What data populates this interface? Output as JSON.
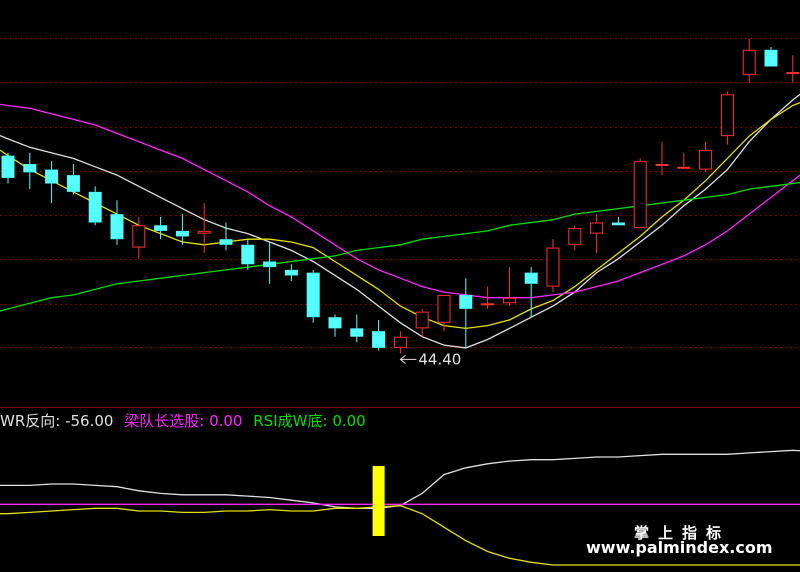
{
  "colors": {
    "background": "#000000",
    "grid": "#7a0000",
    "up": "#ff3232",
    "down": "#54ffff",
    "ma5": "#e0e0e0",
    "ma10": "#e6e000",
    "ma20": "#ff28ff",
    "ma60": "#00dd00",
    "white_line": "#e0e0e0",
    "yellow_line": "#e6e000",
    "magenta_line": "#ff28ff",
    "signal_bar": "#ffff00"
  },
  "legend": {
    "wr_label": "WR反向:",
    "wr_value": "-56.00",
    "lk_label": "梁队长选股:",
    "lk_value": "0.00",
    "rsi_label": "RSI成W底:",
    "rsi_value": "0.00"
  },
  "low_marker": "44.40",
  "watermark": {
    "line1": "掌上指标",
    "line2": "www.palmindex.com"
  },
  "chart_data": [
    {
      "type": "candlestick",
      "title": "",
      "ylim": [
        42.4,
        56.4
      ],
      "low_annotation": 44.4,
      "candles": [
        {
          "o": 51.1,
          "h": 51.2,
          "l": 50.1,
          "c": 50.3
        },
        {
          "o": 50.8,
          "h": 51.2,
          "l": 49.9,
          "c": 50.5
        },
        {
          "o": 50.6,
          "h": 50.9,
          "l": 49.4,
          "c": 50.1
        },
        {
          "o": 50.4,
          "h": 50.8,
          "l": 49.7,
          "c": 49.8
        },
        {
          "o": 49.8,
          "h": 50.0,
          "l": 48.6,
          "c": 48.7
        },
        {
          "o": 49.0,
          "h": 49.5,
          "l": 47.9,
          "c": 48.1
        },
        {
          "o": 47.8,
          "h": 48.9,
          "l": 47.4,
          "c": 48.6
        },
        {
          "o": 48.6,
          "h": 48.9,
          "l": 48.1,
          "c": 48.4
        },
        {
          "o": 48.4,
          "h": 49.0,
          "l": 47.9,
          "c": 48.2
        },
        {
          "o": 48.3,
          "h": 49.4,
          "l": 47.6,
          "c": 48.4
        },
        {
          "o": 48.1,
          "h": 48.7,
          "l": 47.7,
          "c": 47.9
        },
        {
          "o": 47.9,
          "h": 48.1,
          "l": 47.0,
          "c": 47.2
        },
        {
          "o": 47.3,
          "h": 48.0,
          "l": 46.5,
          "c": 47.1
        },
        {
          "o": 47.0,
          "h": 47.2,
          "l": 46.6,
          "c": 46.8
        },
        {
          "o": 46.9,
          "h": 47.0,
          "l": 45.1,
          "c": 45.3
        },
        {
          "o": 45.3,
          "h": 45.4,
          "l": 44.6,
          "c": 44.9
        },
        {
          "o": 44.9,
          "h": 45.4,
          "l": 44.4,
          "c": 44.6
        },
        {
          "o": 44.8,
          "h": 45.2,
          "l": 44.1,
          "c": 44.2
        },
        {
          "o": 44.2,
          "h": 44.8,
          "l": 44.0,
          "c": 44.6
        },
        {
          "o": 44.9,
          "h": 45.6,
          "l": 44.6,
          "c": 45.5
        },
        {
          "o": 45.1,
          "h": 46.1,
          "l": 44.8,
          "c": 46.1
        },
        {
          "o": 46.1,
          "h": 46.7,
          "l": 44.2,
          "c": 45.6
        },
        {
          "o": 45.8,
          "h": 46.4,
          "l": 45.6,
          "c": 45.8
        },
        {
          "o": 45.8,
          "h": 47.1,
          "l": 45.7,
          "c": 46.0
        },
        {
          "o": 46.9,
          "h": 47.1,
          "l": 45.3,
          "c": 46.5
        },
        {
          "o": 46.4,
          "h": 48.1,
          "l": 46.2,
          "c": 47.8
        },
        {
          "o": 47.9,
          "h": 48.6,
          "l": 47.7,
          "c": 48.5
        },
        {
          "o": 48.3,
          "h": 49.0,
          "l": 47.6,
          "c": 48.7
        },
        {
          "o": 48.7,
          "h": 48.9,
          "l": 48.6,
          "c": 48.6
        },
        {
          "o": 48.5,
          "h": 51.0,
          "l": 48.5,
          "c": 50.9
        },
        {
          "o": 50.8,
          "h": 51.6,
          "l": 50.4,
          "c": 50.8
        },
        {
          "o": 50.7,
          "h": 51.2,
          "l": 50.7,
          "c": 50.7
        },
        {
          "o": 50.6,
          "h": 51.6,
          "l": 50.5,
          "c": 51.3
        },
        {
          "o": 51.8,
          "h": 53.4,
          "l": 51.5,
          "c": 53.3
        },
        {
          "o": 54.0,
          "h": 55.3,
          "l": 53.7,
          "c": 54.9
        },
        {
          "o": 54.9,
          "h": 55.0,
          "l": 54.3,
          "c": 54.3
        },
        {
          "o": 54.1,
          "h": 54.7,
          "l": 53.7,
          "c": 54.1
        },
        {
          "o": 54.3,
          "h": 54.9,
          "l": 53.7,
          "c": 54.7
        },
        {
          "o": 54.7,
          "h": 55.1,
          "l": 53.5,
          "c": 53.8
        }
      ],
      "moving_averages": [
        {
          "values": [
            51.7,
            51.4,
            51.2,
            51.0,
            50.7,
            50.4,
            50.0,
            49.6,
            49.2,
            48.8,
            48.5,
            48.3,
            48.0,
            47.7,
            47.3,
            46.8,
            46.3,
            45.7,
            45.1,
            44.6,
            44.3,
            44.2,
            44.5,
            44.9,
            45.3,
            45.7,
            46.2,
            46.9,
            47.4,
            48.0,
            48.6,
            49.3,
            49.9,
            50.6,
            51.6,
            52.4,
            53.1,
            53.7,
            54.1
          ]
        },
        {
          "values": [
            51.1,
            50.6,
            50.2,
            49.8,
            49.4,
            49.0,
            48.6,
            48.3,
            48.0,
            47.9,
            48.0,
            48.1,
            48.1,
            48.0,
            47.8,
            47.3,
            46.8,
            46.3,
            45.7,
            45.3,
            45.0,
            44.9,
            45.0,
            45.2,
            45.6,
            45.9,
            46.4,
            47.0,
            47.6,
            48.2,
            48.9,
            49.5,
            50.2,
            51.0,
            51.8,
            52.4,
            52.9,
            53.2,
            53.5
          ]
        },
        {
          "values": [
            52.9,
            52.8,
            52.6,
            52.4,
            52.2,
            51.9,
            51.6,
            51.3,
            51.0,
            50.6,
            50.2,
            49.8,
            49.3,
            48.9,
            48.4,
            47.9,
            47.4,
            47.0,
            46.7,
            46.4,
            46.2,
            46.1,
            46.0,
            46.0,
            46.0,
            46.1,
            46.2,
            46.4,
            46.6,
            46.9,
            47.2,
            47.5,
            47.9,
            48.4,
            49.0,
            49.6,
            50.2,
            50.8,
            51.4
          ]
        },
        {
          "values": [
            45.6,
            45.8,
            46.0,
            46.1,
            46.3,
            46.5,
            46.6,
            46.7,
            46.8,
            46.9,
            47.0,
            47.1,
            47.2,
            47.3,
            47.4,
            47.5,
            47.7,
            47.8,
            47.9,
            48.1,
            48.2,
            48.3,
            48.4,
            48.6,
            48.7,
            48.8,
            49.0,
            49.1,
            49.2,
            49.3,
            49.4,
            49.5,
            49.6,
            49.7,
            49.9,
            50.0,
            50.1,
            50.2,
            50.3
          ]
        }
      ]
    },
    {
      "type": "line",
      "title": "",
      "ylim": [
        0,
        100
      ],
      "x": [
        0,
        1,
        2,
        3,
        4,
        5,
        6,
        7,
        8,
        9,
        10,
        11,
        12,
        13,
        14,
        15,
        16,
        17,
        18,
        19,
        20,
        21,
        22,
        23,
        24,
        25,
        26,
        27,
        28,
        29,
        30,
        31,
        32,
        33,
        34,
        35,
        36,
        37,
        38
      ],
      "series": [
        {
          "values": [
            59,
            59,
            60,
            60,
            59,
            58,
            55,
            53,
            52,
            52,
            52,
            51,
            50,
            48,
            46,
            43,
            42,
            42,
            44,
            53,
            67,
            72,
            75,
            77,
            78,
            78,
            79,
            80,
            80,
            81,
            82,
            82,
            82,
            82,
            83,
            84,
            85,
            84,
            83
          ]
        },
        {
          "values": [
            38,
            39,
            40,
            41,
            42,
            42,
            40,
            40,
            39,
            39,
            40,
            40,
            41,
            40,
            40,
            42,
            42,
            43,
            44,
            38,
            28,
            18,
            10,
            5,
            2,
            0,
            0,
            0,
            0,
            0,
            0,
            0,
            0,
            0,
            0,
            0,
            0,
            0,
            3
          ]
        },
        {
          "values": [
            45,
            45,
            45,
            45,
            45,
            45,
            45,
            45,
            45,
            45,
            45,
            45,
            45,
            45,
            45,
            45,
            45,
            45,
            45,
            45,
            45,
            45,
            45,
            45,
            45,
            45,
            45,
            45,
            45,
            45,
            45,
            45,
            45,
            45,
            45,
            45,
            45,
            45,
            45
          ]
        }
      ],
      "signal_bar_index": 17
    }
  ]
}
